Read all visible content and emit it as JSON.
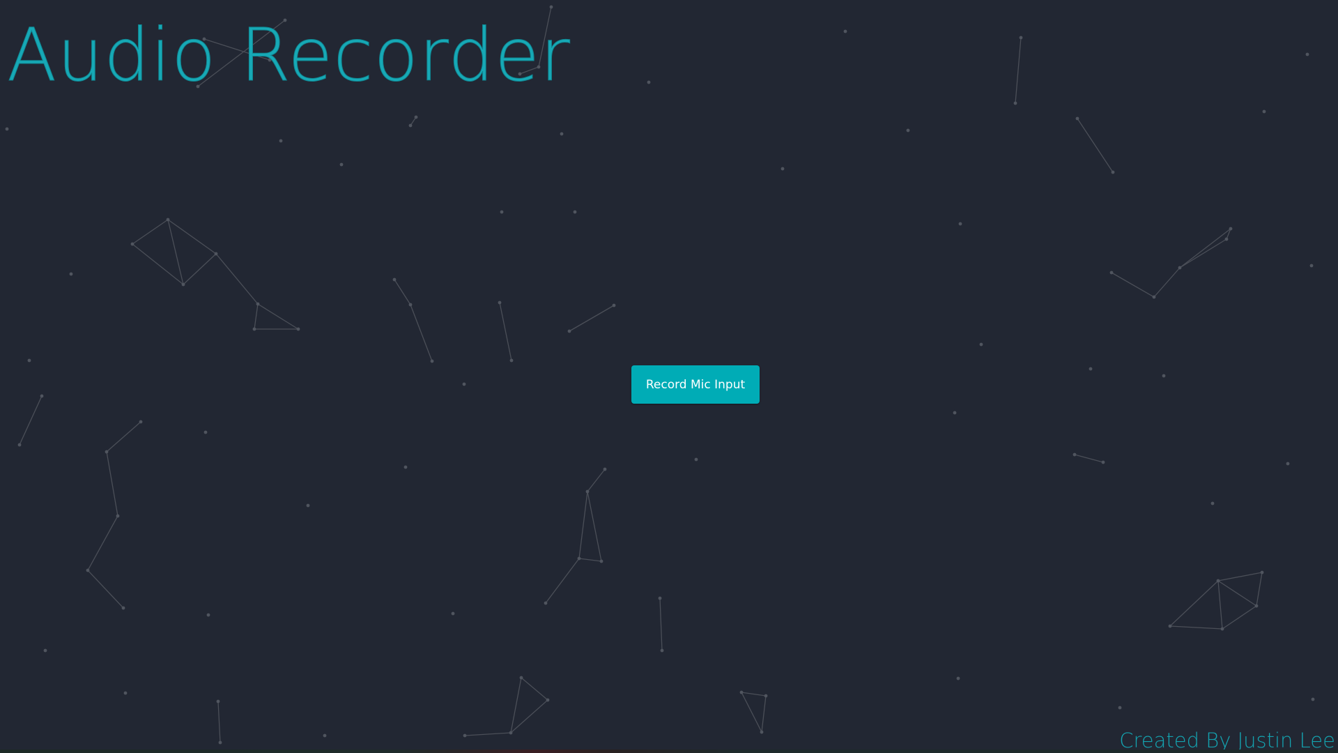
{
  "app": {
    "title": "Audio Recorder"
  },
  "controls": {
    "record_label": "Record Mic Input"
  },
  "footer": {
    "credit": "Created By Justin Lee"
  },
  "theme": {
    "background": "#222733",
    "accent": "#00acb6",
    "particle": "#4a4f59"
  }
}
